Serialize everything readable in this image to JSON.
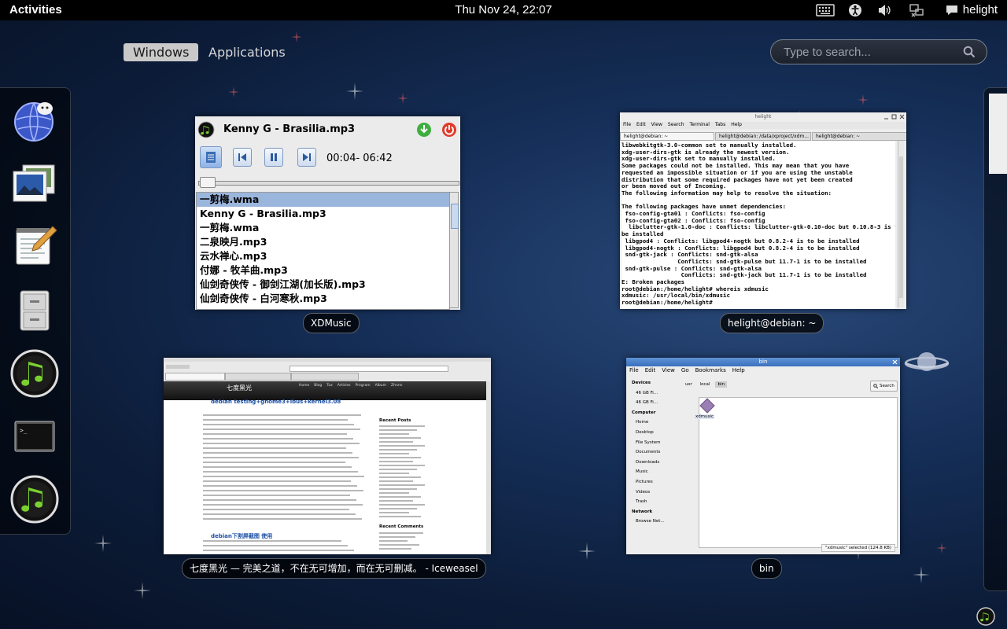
{
  "topbar": {
    "activities": "Activities",
    "clock": "Thu Nov 24, 22:07",
    "user": "helight",
    "tray_icons": [
      "keyboard-icon",
      "accessibility-icon",
      "volume-icon",
      "network-icon",
      "chat-icon"
    ]
  },
  "overview": {
    "tabs": [
      "Windows",
      "Applications"
    ],
    "active_tab": "Windows",
    "search_placeholder": "Type to search..."
  },
  "dash": {
    "items": [
      "chat-client-icon",
      "image-viewer-icon",
      "text-editor-icon",
      "file-cabinet-icon",
      "music-player-icon",
      "terminal-icon",
      "music-player-icon"
    ]
  },
  "windows": {
    "xdmusic": {
      "caption": "XDMusic",
      "title": "Kenny G - Brasilia.mp3",
      "time": "00:04- 06:42",
      "playlist": [
        "一剪梅.wma",
        "Kenny G - Brasilia.mp3",
        "一剪梅.wma",
        "二泉映月.mp3",
        "云水禅心.mp3",
        "付娜 - 牧羊曲.mp3",
        "仙剑奇侠传 - 御剑江湖(加长版).mp3",
        "仙剑奇侠传 - 白河寒秋.mp3"
      ]
    },
    "terminal": {
      "caption": "helight@debian: ~",
      "menu": [
        "File",
        "Edit",
        "View",
        "Search",
        "Terminal",
        "Tabs",
        "Help"
      ],
      "title": "helight",
      "tabs": [
        "helight@debian: ~",
        "helight@debian: /data/xproject/xdm...",
        "helight@debian: ~"
      ],
      "lines": [
        "libwebkitgtk-3.0-common set to manually installed.",
        "xdg-user-dirs-gtk is already the newest version.",
        "xdg-user-dirs-gtk set to manually installed.",
        "Some packages could not be installed. This may mean that you have",
        "requested an impossible situation or if you are using the unstable",
        "distribution that some required packages have not yet been created",
        "or been moved out of Incoming.",
        "The following information may help to resolve the situation:",
        "",
        "The following packages have unmet dependencies:",
        " fso-config-gta01 : Conflicts: fso-config",
        " fso-config-gta02 : Conflicts: fso-config",
        "  libclutter-gtk-1.0-doc : Conflicts: libclutter-gtk-0.10-doc but 0.10.8-3 is to",
        "be installed",
        " libgpod4 : Conflicts: libgpod4-nogtk but 0.8.2-4 is to be installed",
        " libgpod4-nogtk : Conflicts: libgpod4 but 0.8.2-4 is to be installed",
        " snd-gtk-jack : Conflicts: snd-gtk-alsa",
        "                Conflicts: snd-gtk-pulse but 11.7-1 is to be installed",
        " snd-gtk-pulse : Conflicts: snd-gtk-alsa",
        "                 Conflicts: snd-gtk-jack but 11.7-1 is to be installed",
        "E: Broken packages",
        "root@debian:/home/helight# whereis xdmusic",
        "xdmusic: /usr/local/bin/xdmusic",
        "root@debian:/home/helight# "
      ]
    },
    "browser": {
      "caption": "七度黑光 — 完美之道，不在无可增加，而在无可删减。 - Iceweasel",
      "site_title": "七度黑光",
      "nav": [
        "Home",
        "Blog",
        "Tux",
        "Articles",
        "Program",
        "Album",
        "Zhnnn"
      ],
      "post_title_1": "debian testing+gnome3+ibus+kernel3.08",
      "post_title_2": "debian下割屏截图 使用",
      "sidebar_headers": [
        "Recent Posts",
        "Recent Comments"
      ]
    },
    "files": {
      "caption": "bin",
      "title": "bin",
      "menu": [
        "File",
        "Edit",
        "View",
        "Go",
        "Bookmarks",
        "Help"
      ],
      "path": [
        "usr",
        "local",
        "bin"
      ],
      "search_label": "Search",
      "sidebar": {
        "devices_header": "Devices",
        "devices": [
          "46 GB Fi...",
          "46 GB Fi..."
        ],
        "computer_header": "Computer",
        "computer": [
          "Home",
          "Desktop",
          "File System",
          "Documents",
          "Downloads",
          "Music",
          "Pictures",
          "Videos",
          "Trash"
        ],
        "network_header": "Network",
        "network": [
          "Browse Net..."
        ]
      },
      "file": "xdmusic",
      "status": "\"xdmusic\" selected (124.8 KB)"
    }
  },
  "colors": {
    "topbar": "#000000",
    "active_tab": "#c9c9c9",
    "selection": "#9bb6dc",
    "fm_titlebar": "#3970bd"
  }
}
